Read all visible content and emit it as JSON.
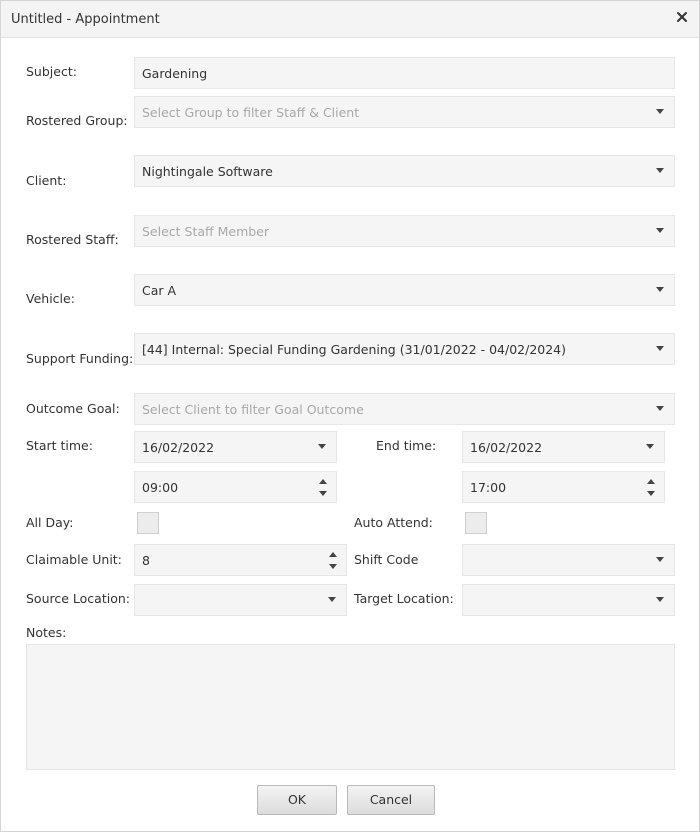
{
  "window": {
    "title": "Untitled - Appointment"
  },
  "form": {
    "subject": {
      "label": "Subject:",
      "value": "Gardening"
    },
    "rostered_group": {
      "label": "Rostered Group:",
      "placeholder": "Select Group to filter Staff & Client"
    },
    "client": {
      "label": "Client:",
      "value": "Nightingale Software"
    },
    "rostered_staff": {
      "label": "Rostered Staff:",
      "placeholder": "Select Staff Member"
    },
    "vehicle": {
      "label": "Vehicle:",
      "value": "Car A"
    },
    "support_funding": {
      "label": "Support Funding:",
      "value": "[44] Internal: Special Funding Gardening (31/01/2022 - 04/02/2024)"
    },
    "outcome_goal": {
      "label": "Outcome Goal:",
      "placeholder": "Select Client to filter Goal Outcome"
    },
    "start_time": {
      "label": "Start time:",
      "date": "16/02/2022",
      "time": "09:00"
    },
    "end_time": {
      "label": "End time:",
      "date": "16/02/2022",
      "time": "17:00"
    },
    "all_day": {
      "label": "All Day:",
      "checked": false
    },
    "auto_attend": {
      "label": "Auto Attend:",
      "checked": false
    },
    "claimable_unit": {
      "label": "Claimable Unit:",
      "value": "8"
    },
    "shift_code": {
      "label": "Shift Code",
      "value": ""
    },
    "source_location": {
      "label": "Source Location:",
      "value": ""
    },
    "target_location": {
      "label": "Target Location:",
      "value": ""
    },
    "notes": {
      "label": "Notes:",
      "value": ""
    }
  },
  "buttons": {
    "ok": "OK",
    "cancel": "Cancel"
  },
  "colors": {
    "field_bg": "#f5f5f5",
    "field_border": "#e6e6e6",
    "placeholder": "#a8a8a8",
    "titlebar_bg": "#f4f4f4"
  }
}
